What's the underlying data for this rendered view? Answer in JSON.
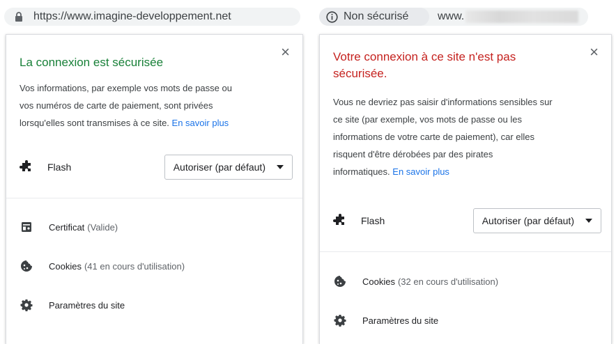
{
  "secure": {
    "url": "https://www.imagine-developpement.net",
    "title": "La connexion est sécurisée",
    "description_lines": [
      "Vos informations, par exemple vos mots de passe ou",
      "vos numéros de carte de paiement, sont privées",
      "lorsqu'elles sont transmises à ce site."
    ],
    "learn_more": "En savoir plus",
    "close": "×",
    "flash": {
      "label": "Flash",
      "select_value": "Autoriser (par défaut)"
    },
    "items": [
      {
        "icon": "certificate-icon",
        "label": "Certificat",
        "detail": "(Valide)"
      },
      {
        "icon": "cookie-icon",
        "label": "Cookies",
        "detail": "(41 en cours d'utilisation)"
      },
      {
        "icon": "gear-icon",
        "label": "Paramètres du site",
        "detail": ""
      }
    ]
  },
  "insecure": {
    "chip_label": "Non sécurisé",
    "url_prefix": "www.",
    "title_lines": [
      "Votre connexion à ce site n'est pas",
      "sécurisée."
    ],
    "description_lines": [
      "Vous ne devriez pas saisir d'informations sensibles sur",
      "ce site (par exemple, vos mots de passe ou les",
      "informations de votre carte de paiement), car elles",
      "risquent d'être dérobées par des pirates",
      "informatiques."
    ],
    "learn_more": "En savoir plus",
    "close": "×",
    "flash": {
      "label": "Flash",
      "select_value": "Autoriser (par défaut)"
    },
    "items": [
      {
        "icon": "cookie-icon",
        "label": "Cookies",
        "detail": "(32 en cours d'utilisation)"
      },
      {
        "icon": "gear-icon",
        "label": "Paramètres du site",
        "detail": ""
      }
    ]
  },
  "colors": {
    "secure_title": "#188038",
    "insecure_title": "#c5221f",
    "link": "#1a73e8"
  }
}
